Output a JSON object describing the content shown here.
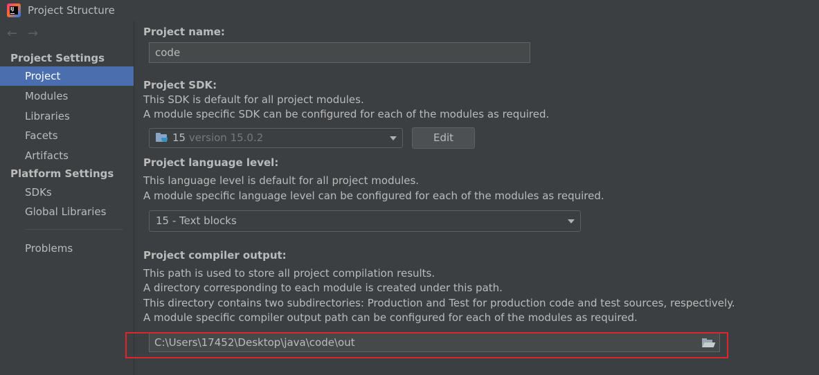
{
  "window": {
    "title": "Project Structure"
  },
  "sidebar": {
    "back_arrow": "←",
    "forward_arrow": "→",
    "project_settings_title": "Project Settings",
    "project_settings_items": [
      {
        "label": "Project",
        "selected": true
      },
      {
        "label": "Modules"
      },
      {
        "label": "Libraries"
      },
      {
        "label": "Facets"
      },
      {
        "label": "Artifacts"
      }
    ],
    "platform_settings_title": "Platform Settings",
    "platform_settings_items": [
      {
        "label": "SDKs"
      },
      {
        "label": "Global Libraries"
      }
    ],
    "problems_label": "Problems"
  },
  "main": {
    "project_name": {
      "label": "Project name:",
      "value": "code"
    },
    "project_sdk": {
      "label": "Project SDK:",
      "desc_line1": "This SDK is default for all project modules.",
      "desc_line2": "A module specific SDK can be configured for each of the modules as required.",
      "selected_name": "15",
      "selected_version": "version 15.0.2",
      "edit_label": "Edit"
    },
    "language_level": {
      "label": "Project language level:",
      "desc_line1": "This language level is default for all project modules.",
      "desc_line2": "A module specific language level can be configured for each of the modules as required.",
      "selected": "15 - Text blocks"
    },
    "compiler_output": {
      "label": "Project compiler output:",
      "desc_line1": "This path is used to store all project compilation results.",
      "desc_line2": "A directory corresponding to each module is created under this path.",
      "desc_line3": "This directory contains two subdirectories: Production and Test for production code and test sources, respectively.",
      "desc_line4": "A module specific compiler output path can be configured for each of the modules as required.",
      "path": "C:\\Users\\17452\\Desktop\\java\\code\\out"
    }
  },
  "colors": {
    "background": "#3c3f41",
    "selection": "#4b6eaf",
    "highlight_box": "#e0242b",
    "text": "#bbbbbb"
  },
  "icons": {
    "app": "intellij-idea-icon",
    "sdk": "java-sdk-folder-icon",
    "browse": "folder-open-icon"
  }
}
